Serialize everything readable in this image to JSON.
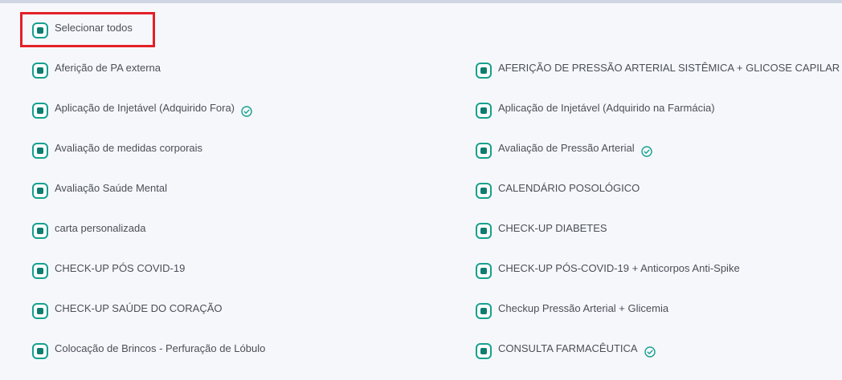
{
  "select_all": {
    "label": "Selecionar todos"
  },
  "items_left": [
    {
      "label": "Aferição de PA externa",
      "verified": false
    },
    {
      "label": "Aplicação de Injetável (Adquirido Fora)",
      "verified": true
    },
    {
      "label": "Avaliação de medidas corporais",
      "verified": false
    },
    {
      "label": "Avaliação Saúde Mental",
      "verified": false
    },
    {
      "label": "carta personalizada",
      "verified": false
    },
    {
      "label": "CHECK-UP PÓS COVID-19",
      "verified": false
    },
    {
      "label": "CHECK-UP SAÚDE DO CORAÇÃO",
      "verified": false
    },
    {
      "label": "Colocação de Brincos - Perfuração de Lóbulo",
      "verified": false
    }
  ],
  "items_right": [
    {
      "label": "AFERIÇÃO DE PRESSÃO ARTERIAL SISTÊMICA + GLICOSE CAPILAR",
      "verified": true
    },
    {
      "label": "Aplicação de Injetável (Adquirido na Farmácia)",
      "verified": false
    },
    {
      "label": "Avaliação de Pressão Arterial",
      "verified": true
    },
    {
      "label": "CALENDÁRIO POSOLÓGICO",
      "verified": false
    },
    {
      "label": "CHECK-UP DIABETES",
      "verified": false
    },
    {
      "label": "CHECK-UP PÓS-COVID-19 + Anticorpos Anti-Spike",
      "verified": false
    },
    {
      "label": "Checkup Pressão Arterial + Glicemia",
      "verified": false
    },
    {
      "label": "CONSULTA FARMACÊUTICA",
      "verified": true
    }
  ],
  "colors": {
    "accent": "#16a08f",
    "checkbox_fill": "#0f7c70",
    "highlight": "#e32028",
    "text": "#4a4f57",
    "background": "#f6f7fb"
  },
  "icons": {
    "checkbox": "checkbox-icon",
    "verified": "check-circle-icon"
  }
}
